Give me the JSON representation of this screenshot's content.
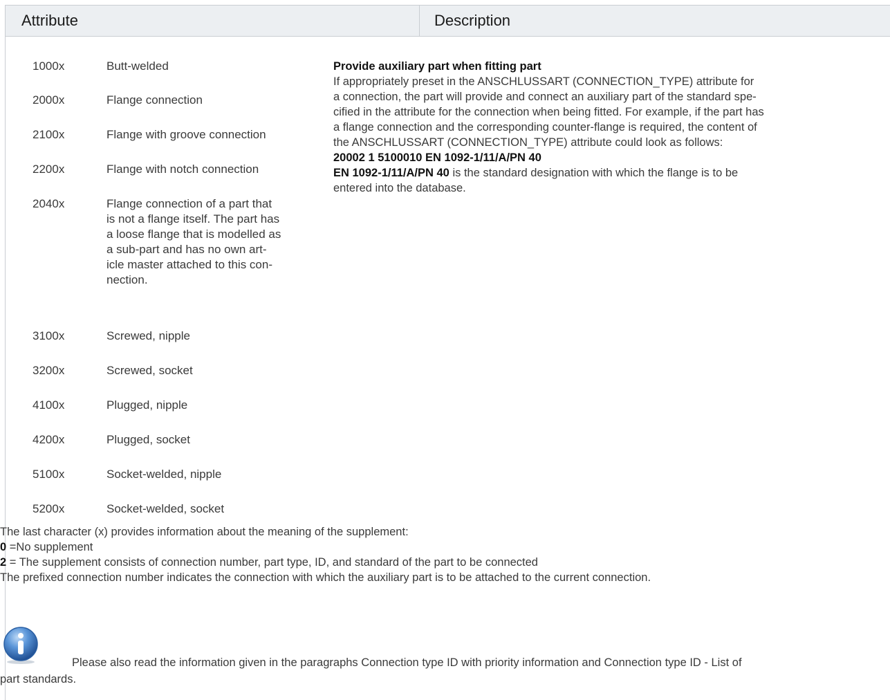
{
  "header": {
    "col1": "Attribute",
    "col2": "Description"
  },
  "rows": [
    {
      "code": "1000x",
      "label": "Butt-welded"
    },
    {
      "code": "2000x",
      "label": "Flange connection"
    },
    {
      "code": "2100x",
      "label": "Flange with groove connection"
    },
    {
      "code": "2200x",
      "label": "Flange with notch connection"
    },
    {
      "code": "2040x",
      "label_lines": [
        "Flange connection of a part that",
        "is not a flange itself. The part has",
        "a loose flange that is modelled as",
        "a sub-part and has no own art-",
        "icle master attached to this con-",
        "nection."
      ]
    },
    {
      "code": "3100x",
      "label": "Screwed, nipple"
    },
    {
      "code": "3200x",
      "label": "Screwed, socket"
    },
    {
      "code": "4100x",
      "label": "Plugged, nipple"
    },
    {
      "code": "4200x",
      "label": "Plugged, socket"
    },
    {
      "code": "5100x",
      "label": "Socket-welded, nipple"
    },
    {
      "code": "5200x",
      "label": "Socket-welded, socket"
    }
  ],
  "description": {
    "title": "Provide auxiliary part when fitting part",
    "lines": [
      "If appropriately preset in the ANSCHLUSSART (CONNECTION_TYPE) attribute for",
      "a connection, the part will provide and connect an auxiliary part of the standard spe-",
      "cified in the attribute for the connection when being fitted. For example, if the part has",
      "a flange connection and the corresponding counter-flange is required, the content of",
      "the ANSCHLUSSART (CONNECTION_TYPE) attribute could look as follows:"
    ],
    "example": "20002 1 5100010 EN 1092-1/11/A/PN 40",
    "std_bold": "EN 1092-1/11/A/PN 40",
    "std_rest_1": " is the standard designation with which the flange is to be",
    "std_rest_2": "entered into the database."
  },
  "notes": {
    "line1": "The last character (x) provides information about the meaning of the supplement:",
    "n0": "0",
    "n0_text": " =No supplement",
    "n2": "2",
    "n2_text": " = The supplement consists of connection number, part type, ID, and standard of the part to be connected",
    "line4": "The prefixed connection number indicates the connection with which the auxiliary part is to be attached to the current connection."
  },
  "info": {
    "icon": "info-icon",
    "text_1": "Please also read the information given in the paragraphs Connection type ID with priority information and Connection type ID - List of",
    "text_2": "part standards."
  },
  "colors": {
    "header_bg": "#eceff2",
    "border": "#c9cdd2",
    "icon": "#3f7cc4"
  }
}
